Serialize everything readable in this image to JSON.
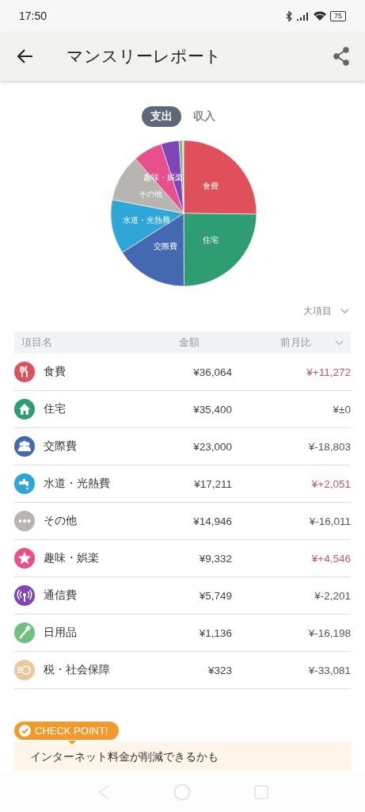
{
  "status_bar": {
    "time": "17:50",
    "battery": "75"
  },
  "app_bar": {
    "title": "マンスリーレポート"
  },
  "toggle": [
    {
      "label": "支出",
      "selected": true
    },
    {
      "label": "収入",
      "selected": false
    }
  ],
  "pie": {
    "labels": [
      {
        "kind": "star",
        "text": "趣味・娯楽"
      },
      {
        "kind": "food",
        "text": "食費"
      },
      {
        "kind": "dots",
        "text": "その他"
      },
      {
        "kind": "tap",
        "text": "水道・光熱費"
      },
      {
        "kind": "house",
        "text": "住宅"
      },
      {
        "kind": "people",
        "text": "交際費"
      }
    ]
  },
  "level_select": {
    "value": "大項目"
  },
  "table": {
    "columns": [
      "項目名",
      "金額",
      "前月比"
    ],
    "rows": [
      {
        "kind": "food",
        "color": "#e0505a",
        "name": "食費",
        "amount": "¥36,064",
        "diff": "¥+11,272",
        "increased": true
      },
      {
        "kind": "house",
        "color": "#2e9e72",
        "name": "住宅",
        "amount": "¥35,400",
        "diff": "¥±0",
        "increased": false
      },
      {
        "kind": "people",
        "color": "#4469b0",
        "name": "交際費",
        "amount": "¥23,000",
        "diff": "¥-18,803",
        "increased": false
      },
      {
        "kind": "tap",
        "color": "#2ea6d8",
        "name": "水道・光熱費",
        "amount": "¥17,211",
        "diff": "¥+2,051",
        "increased": true
      },
      {
        "kind": "dots",
        "color": "#b8b5b0",
        "name": "その他",
        "amount": "¥14,946",
        "diff": "¥-16,011",
        "increased": false
      },
      {
        "kind": "star",
        "color": "#e8508c",
        "name": "趣味・娯楽",
        "amount": "¥9,332",
        "diff": "¥+4,546",
        "increased": true
      },
      {
        "kind": "antenna",
        "color": "#7f45b8",
        "name": "通信費",
        "amount": "¥5,749",
        "diff": "¥-2,201",
        "increased": false
      },
      {
        "kind": "brush",
        "color": "#6fbf7e",
        "name": "日用品",
        "amount": "¥1,136",
        "diff": "¥-16,198",
        "increased": false
      },
      {
        "kind": "coin",
        "color": "#e9c9a0",
        "name": "税・社会保障",
        "amount": "¥323",
        "diff": "¥-33,081",
        "increased": false
      }
    ]
  },
  "check_point": {
    "badge": "CHECK POINT!",
    "text": "インターネット料金が削減できるかも"
  }
}
